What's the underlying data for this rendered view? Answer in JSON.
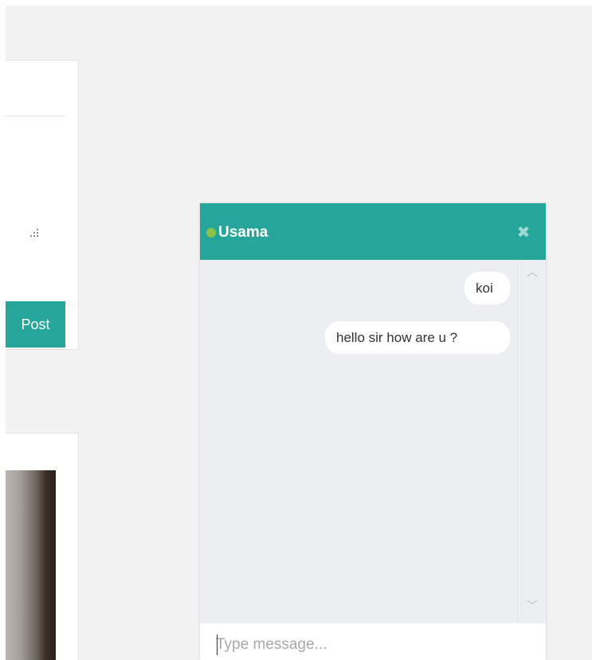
{
  "composer": {
    "post_label": "Post"
  },
  "chat": {
    "contact_name": "Usama",
    "status": "online",
    "status_color": "#8bc34a",
    "header_color": "#26a69a",
    "close_icon": "close-icon",
    "messages": [
      {
        "text": "koi"
      },
      {
        "text": "hello sir how are u ?"
      }
    ],
    "input": {
      "value": "",
      "placeholder": "Type message..."
    }
  }
}
